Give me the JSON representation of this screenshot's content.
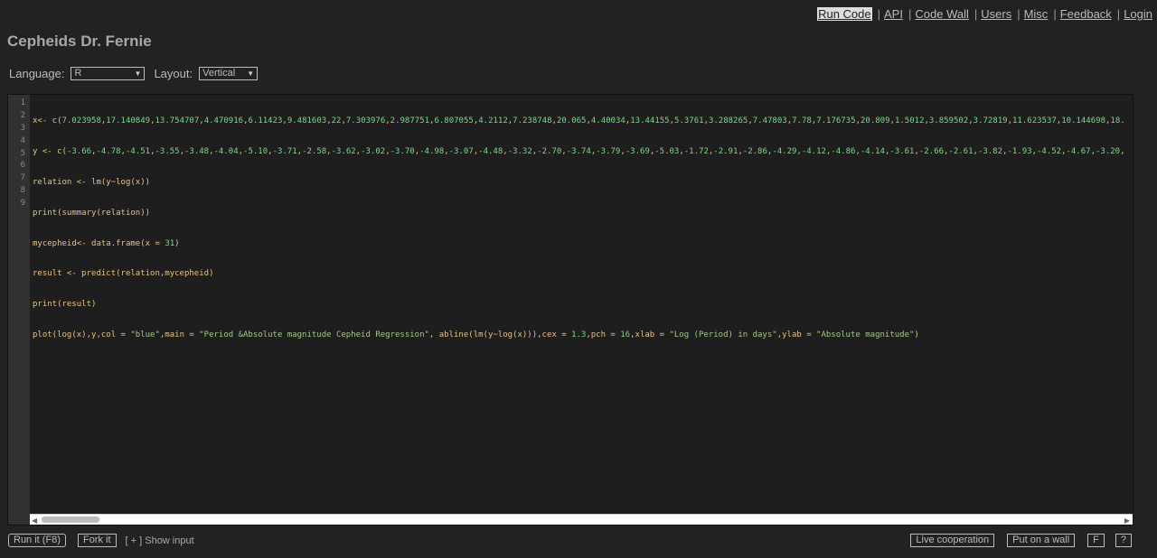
{
  "nav": {
    "items": [
      {
        "label": "Run Code"
      },
      {
        "label": "API"
      },
      {
        "label": "Code Wall"
      },
      {
        "label": "Users"
      },
      {
        "label": "Misc"
      },
      {
        "label": "Feedback"
      },
      {
        "label": "Login"
      }
    ],
    "separator": "|"
  },
  "page": {
    "title": "Cepheids Dr. Fernie"
  },
  "options": {
    "language_label": "Language:",
    "language_value": "R",
    "layout_label": "Layout:",
    "layout_value": "Vertical"
  },
  "editor": {
    "line_numbers": [
      "1",
      "2",
      "3",
      "4",
      "5",
      "6",
      "7",
      "8",
      "9"
    ],
    "lines": [
      "x<- c(7.023958,17.140849,13.754707,4.470916,6.11423,9.481603,22,7.303976,2.987751,6.807055,4.2112,7.238748,20.065,4.40034,13.44155,5.3761,3.288265,7.47803,7.78,7.176735,20.809,1.5012,3.859502,3.72819,11.623537,10.144698,18.",
      "y <- c(-3.66,-4.78,-4.51,-3.55,-3.48,-4.04,-5.10,-3.71,-2.58,-3.62,-3.02,-3.70,-4.98,-3.07,-4.48,-3.32,-2.70,-3.74,-3.79,-3.69,-5.03,-1.72,-2.91,-2.86,-4.29,-4.12,-4.86,-4.14,-3.61,-2.66,-2.61,-3.82,-1.93,-4.52,-4.67,-3.20,",
      "relation <- lm(y~log(x))",
      "print(summary(relation))",
      "mycepheid<- data.frame(x = 31)",
      "result <- predict(relation,mycepheid)",
      "print(result)",
      "plot(log(x),y,col = \"blue\",main = \"Period &Absolute magnitude Cepheid Regression\", abline(lm(y~log(x))),cex = 1.3,pch = 16,xlab = \"Log (Period) in days\",ylab = \"Absolute magnitude\")",
      ""
    ]
  },
  "actions": {
    "run_label": "Run it (F8)",
    "fork_label": "Fork it",
    "show_input_label": "[ + ] Show input",
    "live_cooperation_label": "Live cooperation",
    "put_on_wall_label": "Put on a wall",
    "f_label": "F",
    "help_label": "?"
  },
  "colors": {
    "background": "#222222",
    "editor_bg": "#1e1e1e",
    "code_text": "#e7c27d",
    "code_string": "#a8c77e",
    "code_number": "#7ad88a"
  }
}
